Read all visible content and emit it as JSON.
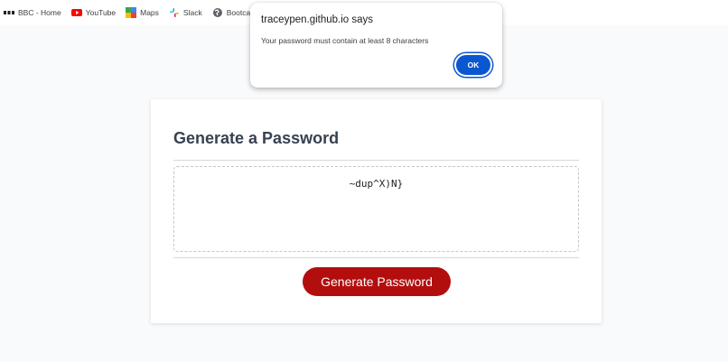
{
  "bookmarks": {
    "items": [
      {
        "label": "BBC - Home",
        "icon": "bbc-icon"
      },
      {
        "label": "YouTube",
        "icon": "youtube-icon"
      },
      {
        "label": "Maps",
        "icon": "maps-icon"
      },
      {
        "label": "Slack",
        "icon": "slack-icon"
      },
      {
        "label": "Bootcamp",
        "icon": "globe-icon"
      }
    ]
  },
  "alert": {
    "title": "traceypen.github.io says",
    "message": "Your password must contain at least 8 characters",
    "ok_label": "OK"
  },
  "card": {
    "header": "Generate a Password",
    "password_value": "~dup^X)N}",
    "button_label": "Generate Password"
  },
  "colors": {
    "button_red": "#b30e0e",
    "ok_blue": "#0b57d0",
    "header_text": "#374151"
  }
}
